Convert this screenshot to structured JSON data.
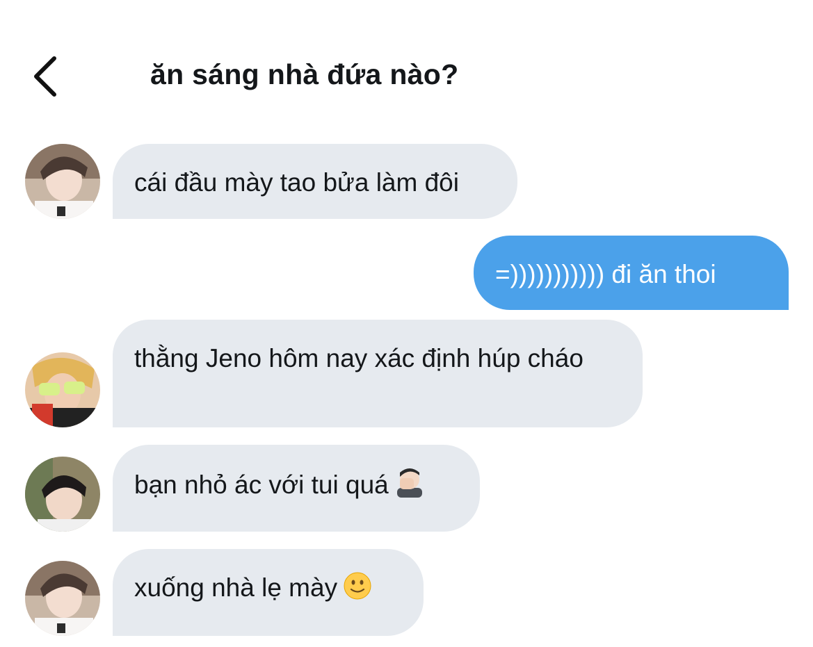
{
  "header": {
    "title": "ăn sáng nhà đứa nào?",
    "back_icon": "chevron-left-icon"
  },
  "colors": {
    "incoming_bubble": "#e6eaef",
    "outgoing_bubble": "#4ba1ea",
    "text": "#14171a"
  },
  "messages": [
    {
      "direction": "incoming",
      "text": "cái đầu mày tao bửa làm đôi",
      "avatar": "avatar-1"
    },
    {
      "direction": "outgoing",
      "text": "=))))))))))) đi ăn thoi"
    },
    {
      "direction": "incoming",
      "text": "thằng Jeno hôm nay xác định húp cháo",
      "avatar": "avatar-2"
    },
    {
      "direction": "incoming",
      "text": "bạn nhỏ ác với tui quá",
      "emoji": "man-facepalming-emoji",
      "avatar": "avatar-3"
    },
    {
      "direction": "incoming",
      "text": "xuống nhà lẹ mày",
      "emoji": "slightly-smiling-face-emoji",
      "avatar": "avatar-1"
    }
  ]
}
